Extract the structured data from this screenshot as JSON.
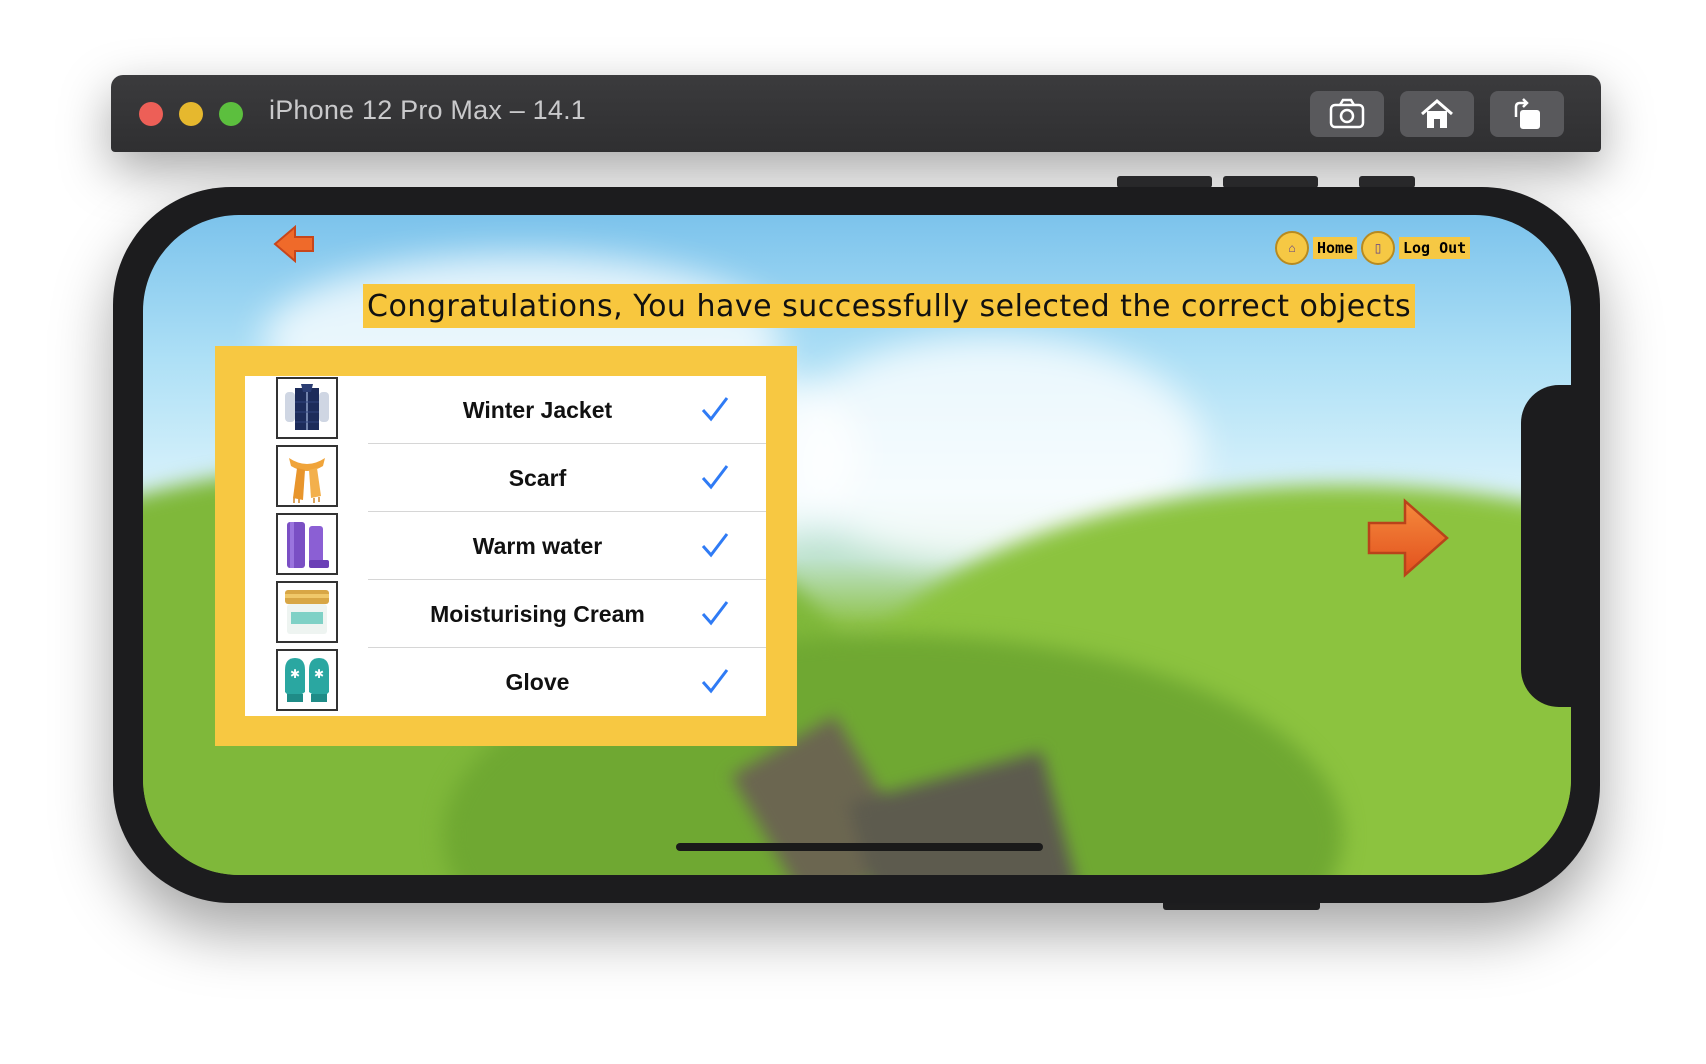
{
  "window": {
    "title": "iPhone 12 Pro Max – 14.1",
    "toolbar": [
      "camera-icon",
      "home-icon",
      "rotate-icon"
    ]
  },
  "nav": {
    "home_label": "Home",
    "logout_label": "Log Out"
  },
  "banner": {
    "text": "Congratulations, You have successfully selected the correct objects"
  },
  "items": [
    {
      "label": "Winter Jacket",
      "icon": "winter-jacket-image",
      "checked": true
    },
    {
      "label": "Scarf",
      "icon": "scarf-image",
      "checked": true
    },
    {
      "label": "Warm water",
      "icon": "water-bottle-image",
      "checked": true
    },
    {
      "label": "Moisturising Cream",
      "icon": "cream-jar-image",
      "checked": true
    },
    {
      "label": "Glove",
      "icon": "gloves-image",
      "checked": true
    }
  ],
  "colors": {
    "banner_bg": "#f8c73e",
    "panel_bg": "#f7c842",
    "check": "#2f7bf5",
    "arrow": "#ef6a2a"
  }
}
